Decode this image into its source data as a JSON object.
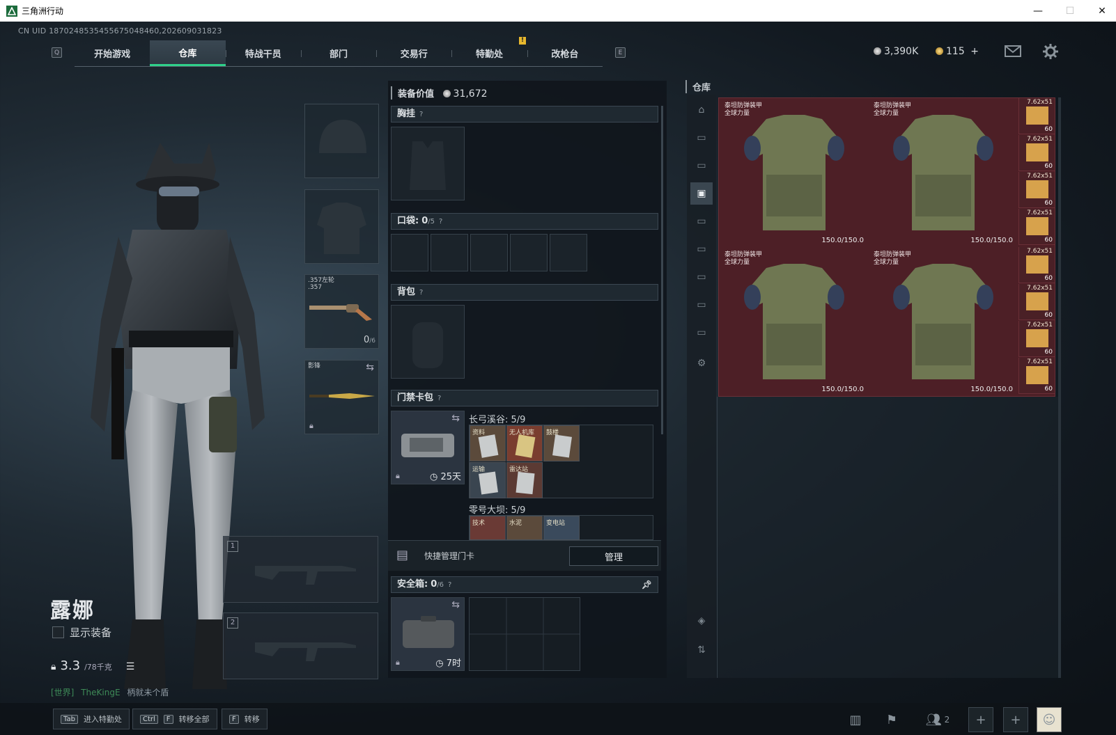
{
  "window": {
    "title": "三角洲行动",
    "minimize": "—",
    "maximize": "☐",
    "close": "✕"
  },
  "uid": "CN UID 1870248535455675048460,202609031823",
  "nav": {
    "left_key": "Q",
    "right_key": "E",
    "tabs": [
      "开始游戏",
      "仓库",
      "特战干员",
      "部门",
      "交易行",
      "特勤处",
      "改枪台"
    ],
    "active_tab": "仓库",
    "notice_badge": "!"
  },
  "currency": {
    "silver": "3,390K",
    "gold": "115",
    "gold_add": "+"
  },
  "character": {
    "name": "露娜",
    "show_equipment_label": "显示装备",
    "weight": "3.3",
    "weight_unit": "/78千克",
    "chat": {
      "channel": "[世界]",
      "user": "TheKingE",
      "message": "柄就未个盾"
    }
  },
  "equipment": {
    "pistol": {
      "label": ".357左轮\n.357",
      "ammo": "0",
      "ammo_max": "/6"
    },
    "melee": {
      "label": "影锋"
    },
    "weapon_slot_1": "1",
    "weapon_slot_2": "2"
  },
  "loadout": {
    "value_label": "装备价值",
    "value": "31,672",
    "chest_rig": {
      "title": "胸挂",
      "hint": "?"
    },
    "pockets": {
      "title": "口袋:",
      "count": "0",
      "max": "/5",
      "hint": "?"
    },
    "backpack": {
      "title": "背包",
      "hint": "?"
    },
    "keycard_wallet": {
      "title": "门禁卡包",
      "hint": "?",
      "time_left": "25天",
      "maps": [
        {
          "name": "长弓溪谷: 5/9",
          "cards": [
            "资料",
            "无人机库",
            "鼓楼",
            "运输",
            "雷达站"
          ]
        },
        {
          "name": "零号大坝: 5/9",
          "cards": [
            "技术",
            "水泥",
            "变电站"
          ]
        }
      ]
    },
    "quick_manage": {
      "label": "快捷管理门卡",
      "button": "管理"
    },
    "safe_box": {
      "title": "安全箱:",
      "count": "0",
      "max": "/6",
      "hint": "?",
      "time_left": "7时"
    }
  },
  "warehouse": {
    "title": "仓库",
    "items": [
      {
        "name": "泰坦防弹装甲\n全球力量",
        "durability": "150.0/150.0"
      },
      {
        "name": "泰坦防弹装甲\n全球力量",
        "durability": "150.0/150.0"
      },
      {
        "name": "泰坦防弹装甲\n全球力量",
        "durability": "150.0/150.0"
      },
      {
        "name": "泰坦防弹装甲\n全球力量",
        "durability": "150.0/150.0"
      }
    ],
    "ammo": [
      {
        "label": "7.62x51",
        "count": "60"
      },
      {
        "label": "7.62x51",
        "count": "60"
      },
      {
        "label": "7.62x51",
        "count": "60"
      },
      {
        "label": "7.62x51",
        "count": "60"
      },
      {
        "label": "7.62x51",
        "count": "60"
      },
      {
        "label": "7.62x51",
        "count": "60"
      },
      {
        "label": "7.62x51",
        "count": "60"
      },
      {
        "label": "7.62x51",
        "count": "60"
      }
    ]
  },
  "bottom": {
    "buttons": [
      {
        "key1": "Tab",
        "key2": "",
        "label": "进入特勤处"
      },
      {
        "key1": "Ctrl",
        "key2": "F",
        "label": "转移全部"
      },
      {
        "key1": "F",
        "key2": "",
        "label": "转移"
      }
    ],
    "friends_count": "2"
  }
}
